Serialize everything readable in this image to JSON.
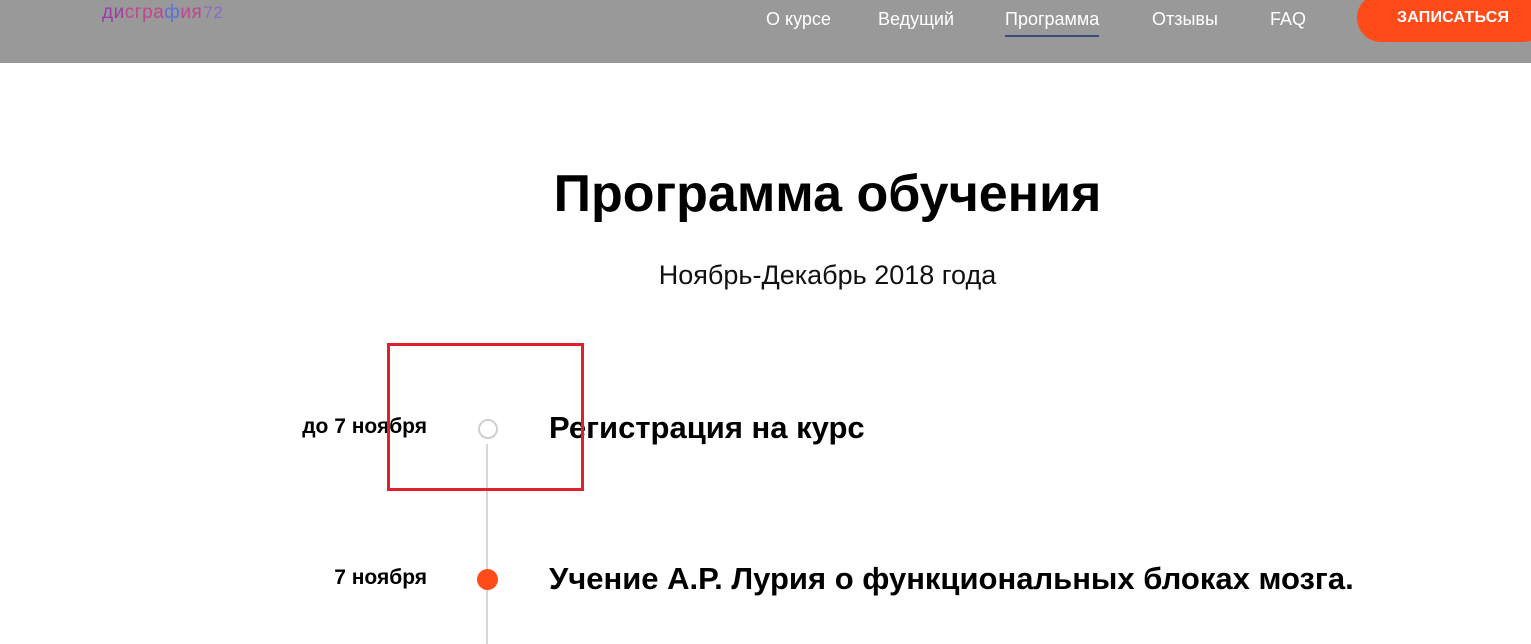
{
  "header": {
    "logo": {
      "part1": "ди",
      "part2": "сгра",
      "part3": "ф",
      "part4": "ия",
      "part5": "72"
    },
    "nav": [
      {
        "label": "О курсе"
      },
      {
        "label": "Ведущий"
      },
      {
        "label": "Программа",
        "active": true
      },
      {
        "label": "Отзывы"
      },
      {
        "label": "FAQ"
      }
    ],
    "cta_label": "ЗАПИСАТЬСЯ"
  },
  "main": {
    "title": "Программа обучения",
    "subtitle": "Ноябрь-Декабрь 2018 года",
    "timeline": [
      {
        "date": "до 7 ноября",
        "title": "Регистрация на курс",
        "state": "upcoming"
      },
      {
        "date": "7 ноября",
        "title": "Учение А.Р. Лурия о функциональных блоках мозга.",
        "state": "current"
      }
    ]
  },
  "colors": {
    "header_bg": "#999999",
    "accent": "#ff4b1a",
    "nav_active_underline": "#3a4a7a",
    "timeline_line": "#d6d6d6",
    "highlight_box": "#e0202a"
  }
}
